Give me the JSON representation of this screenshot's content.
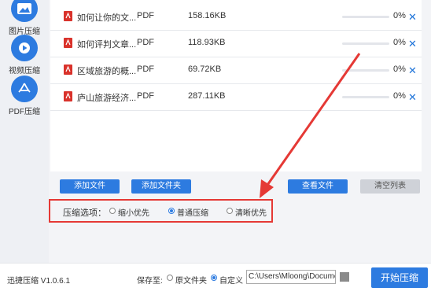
{
  "sidebar": {
    "items": [
      {
        "label": "图片压缩",
        "icon": "image-icon"
      },
      {
        "label": "视频压缩",
        "icon": "video-icon"
      },
      {
        "label": "PDF压缩",
        "icon": "pdf-icon"
      }
    ]
  },
  "files": [
    {
      "name": "如何让你的文...",
      "type": "PDF",
      "size": "158.16KB",
      "progress": "0%"
    },
    {
      "name": "如何评判文章...",
      "type": "PDF",
      "size": "118.93KB",
      "progress": "0%"
    },
    {
      "name": "区域旅游的概...",
      "type": "PDF",
      "size": "69.72KB",
      "progress": "0%"
    },
    {
      "name": "庐山旅游经济...",
      "type": "PDF",
      "size": "287.11KB",
      "progress": "0%"
    }
  ],
  "buttons": {
    "add_file": "添加文件",
    "add_folder": "添加文件夹",
    "view_file": "查看文件",
    "clear_list": "清空列表"
  },
  "options": {
    "label": "压缩选项：",
    "choices": [
      "缩小优先",
      "普通压缩",
      "清晰优先"
    ],
    "selected": "普通压缩"
  },
  "footer": {
    "app_version": "迅捷压缩 V1.0.6.1",
    "save_to_label": "保存至:",
    "save_choices": [
      "原文件夹",
      "自定义"
    ],
    "save_selected": "自定义",
    "path": "C:\\Users\\Mloong\\Docume",
    "start_button": "开始压缩"
  },
  "colors": {
    "accent": "#2d7be0",
    "highlight": "#e53935",
    "pdf_red": "#d9322b"
  }
}
